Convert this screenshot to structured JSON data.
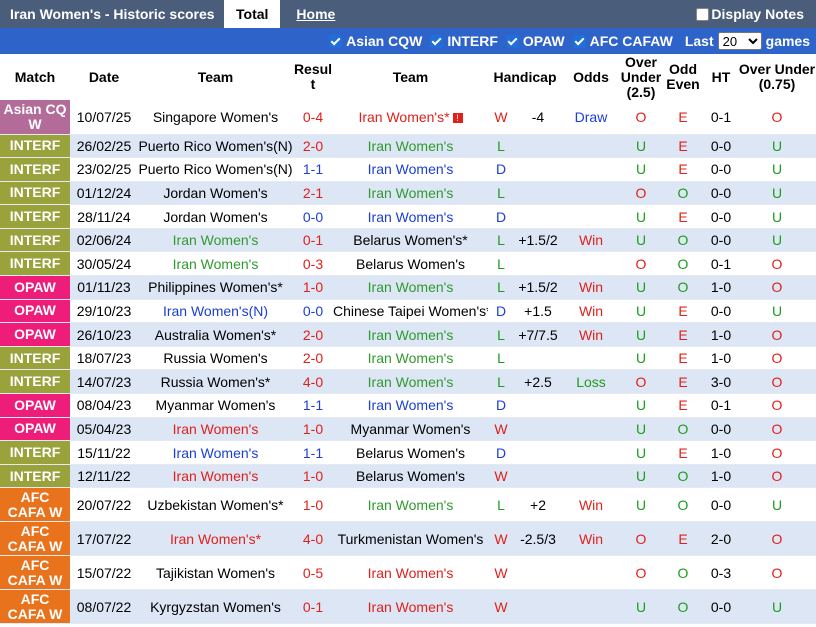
{
  "header": {
    "title": "Iran Women's - Historic scores",
    "tab_total": "Total",
    "tab_home": "Home",
    "display_notes": "Display Notes"
  },
  "filters": {
    "items": [
      "Asian CQW",
      "INTERF",
      "OPAW",
      "AFC CAFAW"
    ],
    "last_label": "Last",
    "last_value": "20",
    "games_label": "games"
  },
  "columns": [
    "Match",
    "Date",
    "Team",
    "Result",
    "Team",
    "Handicap",
    "Odds",
    "Over Under (2.5)",
    "Odd Even",
    "HT",
    "Over Under (0.75)"
  ],
  "colors": {
    "Asian CQ W": "#b36b9a",
    "INTERF": "#99a23b",
    "OPAW": "#ee1d7a",
    "AFC CAFA W": "#e8731c",
    "row_alt": "#dde6f5",
    "win": "#e0201b",
    "draw": "#1b3fd1",
    "loss": "#1b9e1b"
  },
  "rows": [
    {
      "match": "Asian CQ W",
      "date": "10/07/25",
      "home": "Singapore Women's",
      "home_mark": "",
      "score": "0-4",
      "away": "Iran Women's*",
      "away_flag": true,
      "res": "W",
      "hcp": "-4",
      "odds": "Draw",
      "ou": "O",
      "oe": "E",
      "ht": "0-1",
      "ou2": "O"
    },
    {
      "match": "INTERF",
      "date": "26/02/25",
      "home": "Puerto Rico Women's(N)",
      "home_mark": "",
      "score": "2-0",
      "away": "Iran Women's",
      "res": "L",
      "hcp": "",
      "odds": "",
      "ou": "U",
      "oe": "E",
      "ht": "0-0",
      "ou2": "U"
    },
    {
      "match": "INTERF",
      "date": "23/02/25",
      "home": "Puerto Rico Women's(N)",
      "home_mark": "",
      "score": "1-1",
      "away": "Iran Women's",
      "res": "D",
      "hcp": "",
      "odds": "",
      "ou": "U",
      "oe": "E",
      "ht": "0-0",
      "ou2": "U"
    },
    {
      "match": "INTERF",
      "date": "01/12/24",
      "home": "Jordan Women's",
      "home_mark": "",
      "score": "2-1",
      "away": "Iran Women's",
      "res": "L",
      "hcp": "",
      "odds": "",
      "ou": "O",
      "oe": "O",
      "ht": "0-0",
      "ou2": "U"
    },
    {
      "match": "INTERF",
      "date": "28/11/24",
      "home": "Jordan Women's",
      "home_mark": "",
      "score": "0-0",
      "away": "Iran Women's",
      "res": "D",
      "hcp": "",
      "odds": "",
      "ou": "U",
      "oe": "E",
      "ht": "0-0",
      "ou2": "U"
    },
    {
      "match": "INTERF",
      "date": "02/06/24",
      "home": "Iran Women's",
      "home_mark": "",
      "score": "0-1",
      "away": "Belarus Women's*",
      "res": "L",
      "hcp": "+1.5/2",
      "odds": "Win",
      "ou": "U",
      "oe": "O",
      "ht": "0-0",
      "ou2": "U"
    },
    {
      "match": "INTERF",
      "date": "30/05/24",
      "home": "Iran Women's",
      "home_mark": "",
      "score": "0-3",
      "away": "Belarus Women's",
      "res": "L",
      "hcp": "",
      "odds": "",
      "ou": "O",
      "oe": "O",
      "ht": "0-1",
      "ou2": "O"
    },
    {
      "match": "OPAW",
      "date": "01/11/23",
      "home": "Philippines Women's*",
      "home_mark": "",
      "score": "1-0",
      "away": "Iran Women's",
      "res": "L",
      "hcp": "+1.5/2",
      "odds": "Win",
      "ou": "U",
      "oe": "O",
      "ht": "1-0",
      "ou2": "O"
    },
    {
      "match": "OPAW",
      "date": "29/10/23",
      "home": "Iran Women's(N)",
      "home_mark": "",
      "score": "0-0",
      "away": "Chinese Taipei Women's*",
      "res": "D",
      "hcp": "+1.5",
      "odds": "Win",
      "ou": "U",
      "oe": "E",
      "ht": "0-0",
      "ou2": "U"
    },
    {
      "match": "OPAW",
      "date": "26/10/23",
      "home": "Australia Women's*",
      "home_mark": "",
      "score": "2-0",
      "away": "Iran Women's",
      "res": "L",
      "hcp": "+7/7.5",
      "odds": "Win",
      "ou": "U",
      "oe": "E",
      "ht": "1-0",
      "ou2": "O"
    },
    {
      "match": "INTERF",
      "date": "18/07/23",
      "home": "Russia Women's",
      "home_mark": "",
      "score": "2-0",
      "away": "Iran Women's",
      "res": "L",
      "hcp": "",
      "odds": "",
      "ou": "U",
      "oe": "E",
      "ht": "1-0",
      "ou2": "O"
    },
    {
      "match": "INTERF",
      "date": "14/07/23",
      "home": "Russia Women's*",
      "home_mark": "",
      "score": "4-0",
      "away": "Iran Women's",
      "res": "L",
      "hcp": "+2.5",
      "odds": "Loss",
      "ou": "O",
      "oe": "E",
      "ht": "3-0",
      "ou2": "O"
    },
    {
      "match": "OPAW",
      "date": "08/04/23",
      "home": "Myanmar Women's",
      "home_mark": "",
      "score": "1-1",
      "away": "Iran Women's",
      "res": "D",
      "hcp": "",
      "odds": "",
      "ou": "U",
      "oe": "E",
      "ht": "0-1",
      "ou2": "O"
    },
    {
      "match": "OPAW",
      "date": "05/04/23",
      "home": "Iran Women's",
      "home_mark": "",
      "score": "1-0",
      "away": "Myanmar Women's",
      "res": "W",
      "hcp": "",
      "odds": "",
      "ou": "U",
      "oe": "O",
      "ht": "0-0",
      "ou2": "O"
    },
    {
      "match": "INTERF",
      "date": "15/11/22",
      "home": "Iran Women's",
      "home_mark": "",
      "score": "1-1",
      "away": "Belarus Women's",
      "res": "D",
      "hcp": "",
      "odds": "",
      "ou": "U",
      "oe": "E",
      "ht": "1-0",
      "ou2": "O"
    },
    {
      "match": "INTERF",
      "date": "12/11/22",
      "home": "Iran Women's",
      "home_mark": "",
      "score": "1-0",
      "away": "Belarus Women's",
      "res": "W",
      "hcp": "",
      "odds": "",
      "ou": "U",
      "oe": "O",
      "ht": "1-0",
      "ou2": "O"
    },
    {
      "match": "AFC CAFA W",
      "date": "20/07/22",
      "home": "Uzbekistan Women's*",
      "home_mark": "",
      "score": "1-0",
      "away": "Iran Women's",
      "res": "L",
      "hcp": "+2",
      "odds": "Win",
      "ou": "U",
      "oe": "O",
      "ht": "0-0",
      "ou2": "U"
    },
    {
      "match": "AFC CAFA W",
      "date": "17/07/22",
      "home": "Iran Women's*",
      "home_mark": "",
      "score": "4-0",
      "away": "Turkmenistan Women's",
      "res": "W",
      "hcp": "-2.5/3",
      "odds": "Win",
      "ou": "O",
      "oe": "E",
      "ht": "2-0",
      "ou2": "O"
    },
    {
      "match": "AFC CAFA W",
      "date": "15/07/22",
      "home": "Tajikistan Women's",
      "home_mark": "",
      "score": "0-5",
      "away": "Iran Women's",
      "res": "W",
      "hcp": "",
      "odds": "",
      "ou": "O",
      "oe": "O",
      "ht": "0-3",
      "ou2": "O"
    },
    {
      "match": "AFC CAFA W",
      "date": "08/07/22",
      "home": "Kyrgyzstan Women's",
      "home_mark": "",
      "score": "0-1",
      "away": "Iran Women's",
      "res": "W",
      "hcp": "",
      "odds": "",
      "ou": "U",
      "oe": "O",
      "ht": "0-0",
      "ou2": "U"
    }
  ]
}
